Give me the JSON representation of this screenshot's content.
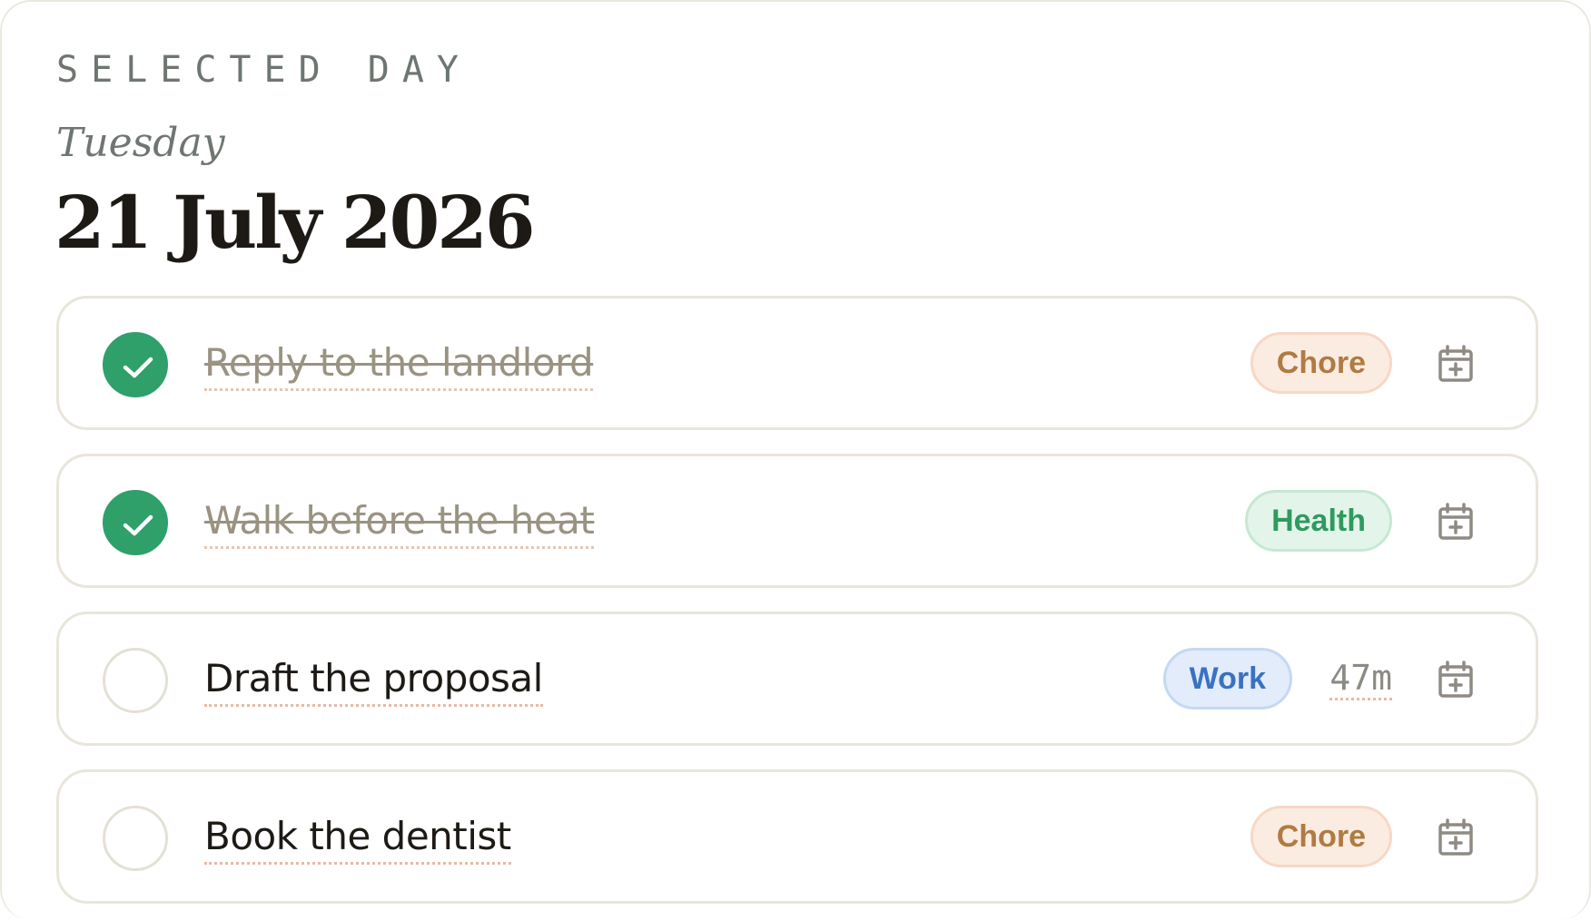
{
  "header": {
    "eyebrow": "SELECTED DAY",
    "weekday": "Tuesday",
    "date": "21 July 2026"
  },
  "tasks": [
    {
      "title": "Reply to the landlord",
      "done": true,
      "tag": "Chore",
      "tag_kind": "chore",
      "duration": ""
    },
    {
      "title": "Walk before the heat",
      "done": true,
      "tag": "Health",
      "tag_kind": "health",
      "duration": ""
    },
    {
      "title": "Draft the proposal",
      "done": false,
      "tag": "Work",
      "tag_kind": "work",
      "duration": "47m"
    },
    {
      "title": "Book the dentist",
      "done": false,
      "tag": "Chore",
      "tag_kind": "chore",
      "duration": ""
    }
  ],
  "icons": {
    "check": "checkmark-icon",
    "schedule": "calendar-plus-icon"
  },
  "colors": {
    "done_green": "#2fa06a",
    "chore": "#b07b42",
    "health": "#2f9a5f",
    "work": "#3a72c2",
    "ink": "#1d1a16"
  }
}
